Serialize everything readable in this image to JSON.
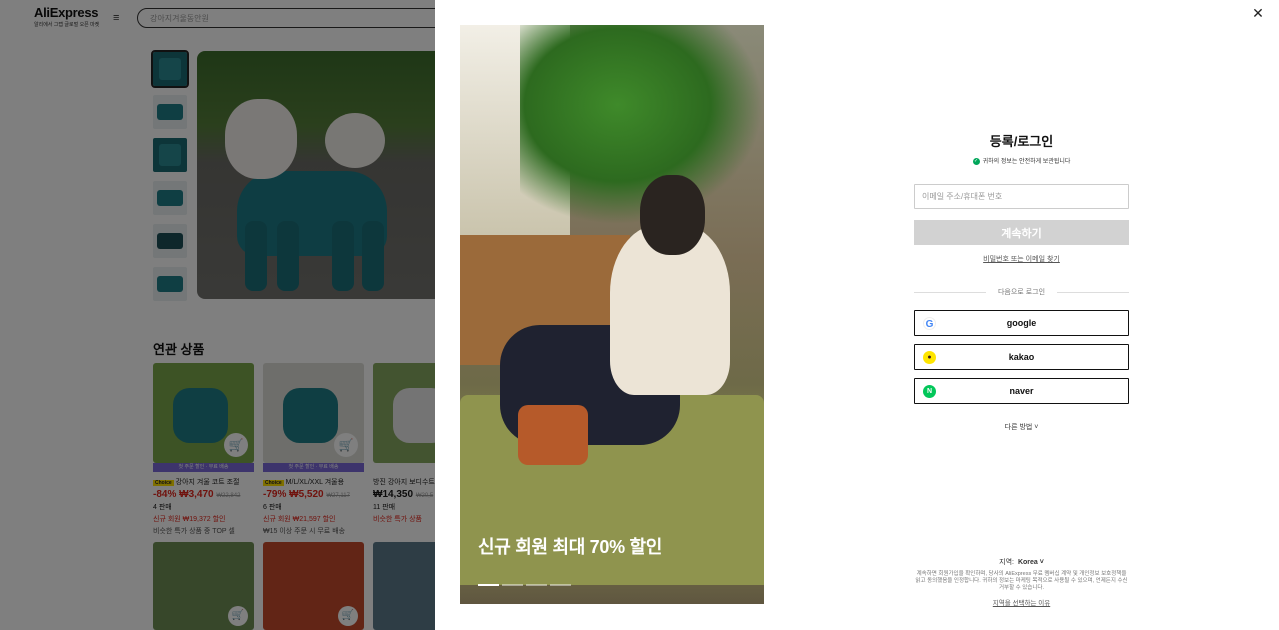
{
  "background": {
    "logo": {
      "name": "AliExpress",
      "tagline": "알리에서 그랩 글로벌 오픈 마켓"
    },
    "search_placeholder": "강아지겨울동안원",
    "related_title": "연관 상품",
    "products": [
      {
        "tag": "첫 주문 할인 · 무료 배송",
        "choice": "Choice",
        "name": "강아지 겨울 코트 조절",
        "discount": "-84%",
        "price": "₩3,470",
        "old_price": "₩22,842",
        "sold": "4 판매",
        "promo": "신규 회원 ₩19,372 할인",
        "note": "비슷한 특가 상품 중 TOP 셀"
      },
      {
        "tag": "첫 주문 할인 · 무료 배송",
        "choice": "Choice",
        "name": "M/L/XL/XXL 겨울용",
        "discount": "-79%",
        "price": "₩5,520",
        "old_price": "₩27,117",
        "sold": "6 판매",
        "promo": "신규 회원 ₩21,597 할인",
        "note": "₩15 이상 주문 시 무료 배송"
      },
      {
        "tag": "",
        "choice": "",
        "name": "방진 강아지 보디수트",
        "discount": "",
        "price": "₩14,350",
        "old_price": "₩20,5",
        "sold": "11 판매",
        "promo": "비슷한 특가 상품",
        "note": ""
      }
    ]
  },
  "modal": {
    "promo_text": "신규 회원 최대 70% 할인",
    "slides": 4,
    "active_slide": 1,
    "title": "등록/로그인",
    "secure_text": "귀하의 정보는 안전하게 보관됩니다",
    "email_placeholder": "이메일 주소/휴대폰 번호",
    "continue_label": "계속하기",
    "forgot_label": "비밀번호 또는 이메일 찾기",
    "divider_label": "다음으로 로그인",
    "social": [
      {
        "label": "google",
        "icon": "google-icon",
        "glyph": "G"
      },
      {
        "label": "kakao",
        "icon": "kakao-icon",
        "glyph": "●"
      },
      {
        "label": "naver",
        "icon": "naver-icon",
        "glyph": "N"
      }
    ],
    "more_label": "다른 방법 ˅",
    "region_label": "지역:",
    "region_value": "Korea ˅",
    "terms_text": "계속하면 회원가입을 확인하며, 당사의 AliExpress 무료 멤버십 계약 및 개인정보 보호정책을 읽고 동의했음을 인정합니다. 귀하의 정보는 마케팅 목적으로 사용될 수 있으며, 언제든지 수신 거부할 수 있습니다.",
    "policy_label": "지역을 선택하는 이유",
    "close_label": "✕"
  },
  "colors": {
    "brand_red": "#e1251b",
    "choice_yellow": "#ffe100",
    "naver_green": "#03c75a",
    "kakao_yellow": "#fee500"
  }
}
